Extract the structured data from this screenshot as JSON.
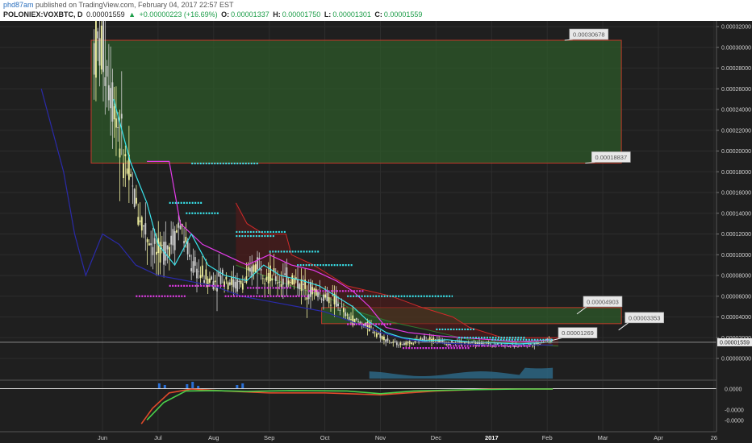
{
  "header": {
    "author": "phd87am",
    "published_text": "published on TradingView.com, February 04, 2017 22:57 EST",
    "symbol": "POLONIEX:VOXBTC, D",
    "last": "0.00001559",
    "change_arrow": "▲",
    "change": "+0.00000223 (+16.69%)",
    "open_label": "O:",
    "open": "0.00001337",
    "high_label": "H:",
    "high": "0.00001750",
    "low_label": "L:",
    "low": "0.00001301",
    "close_label": "C:",
    "close": "0.00001559"
  },
  "colors": {
    "background": "#1f1f1f",
    "grid": "#2d2d2d",
    "candle_up": "#f2f2a0",
    "candle_down": "#cfcfcf",
    "zone": "#2e5a2a",
    "zone_border": "#c03a2a",
    "cyan": "#39e6ee",
    "magenta": "#e23be8",
    "blue": "#2a2aa8",
    "red": "#d02a2a",
    "price_label_bg": "#e8e8e8"
  },
  "chart_data": {
    "type": "candlestick",
    "title": "",
    "x_axis": [
      "Jun",
      "Jul",
      "Aug",
      "Sep",
      "Oct",
      "Nov",
      "Dec",
      "2017",
      "Feb",
      "Mar",
      "Apr",
      "26"
    ],
    "y_axis": {
      "min": 0,
      "max": 0.00032,
      "ticks": [
        "0.00032000",
        "0.00030000",
        "0.00028000",
        "0.00026000",
        "0.00024000",
        "0.00022000",
        "0.00020000",
        "0.00018000",
        "0.00016000",
        "0.00014000",
        "0.00012000",
        "0.00010000",
        "0.00008000",
        "0.00006000",
        "0.00004000",
        "0.00002000",
        "0.00000000"
      ]
    },
    "last_price": "0.00001559",
    "annotations": [
      "0.00030678",
      "0.00018837",
      "0.00004903",
      "0.00003353",
      "0.00001269"
    ],
    "zones": [
      {
        "from": "Jun",
        "to": "Mar",
        "low": 0.00018837,
        "high": 0.00030678
      },
      {
        "from": "Oct",
        "to": "Mar",
        "low": 3.353e-05,
        "high": 4.903e-05
      }
    ],
    "close_series": {
      "t": [
        0.0,
        0.2,
        0.4,
        0.6,
        0.8,
        1.0,
        1.2,
        1.4,
        1.6,
        1.8,
        2.0,
        2.2,
        2.4,
        2.6,
        2.8,
        3.0,
        3.2,
        3.4,
        3.6,
        3.8,
        4.0,
        4.2,
        4.4,
        4.6,
        4.8,
        5.0,
        5.2,
        5.4,
        5.6,
        5.8,
        6.0,
        6.2,
        6.4,
        6.6,
        6.8,
        7.0,
        7.2,
        7.4,
        7.6,
        7.8,
        8.0,
        8.1
      ],
      "v": [
        0.0003,
        0.00025,
        0.00019,
        0.00015,
        0.00012,
        0.0001,
        0.00011,
        0.00013,
        9e-05,
        8e-05,
        7.5e-05,
        8e-05,
        7e-05,
        7.5e-05,
        9.5e-05,
        8e-05,
        7.5e-05,
        7.8e-05,
        7e-05,
        6.5e-05,
        6e-05,
        5.5e-05,
        4e-05,
        3.5e-05,
        3e-05,
        2.2e-05,
        1.5e-05,
        1.4e-05,
        1.5e-05,
        2e-05,
        1.8e-05,
        1.5e-05,
        1.6e-05,
        1.5e-05,
        1.4e-05,
        1.4e-05,
        1.3e-05,
        1.2e-05,
        1.3e-05,
        1.4e-05,
        1.8e-05,
        1.6e-05
      ]
    },
    "oscillator": {
      "y_ticks": [
        "0.0000",
        "-0.0000",
        "-0.0000"
      ]
    }
  }
}
